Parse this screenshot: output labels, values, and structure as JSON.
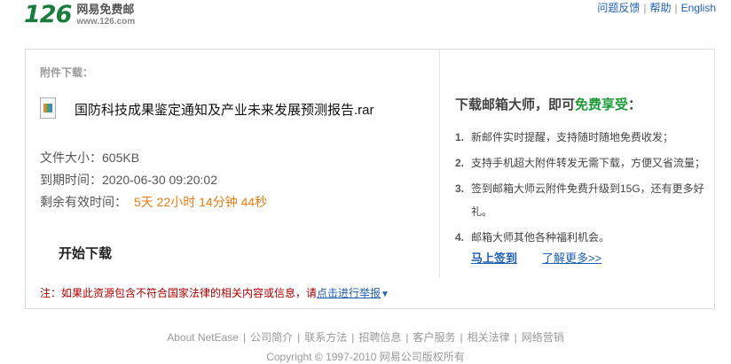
{
  "header": {
    "logo_number": "126",
    "logo_name": "网易免费邮",
    "logo_url": "www.126.com",
    "links": [
      "问题反馈",
      "帮助",
      "English"
    ]
  },
  "attachment": {
    "section_title": "附件下载：",
    "file_name": "国防科技成果鉴定通知及产业未来发展预测报告.rar",
    "size_label": "文件大小：",
    "size_value": "605KB",
    "expire_label": "到期时间：",
    "expire_value": "2020-06-30 09:20:02",
    "remaining_label": "剩余有效时间：",
    "remaining_value": "5天 22小时 14分钟 44秒",
    "download_button": "开始下载",
    "note_prefix": "注：如果此资源包含不符合国家法律的相关内容或信息，请",
    "note_link": "点击进行举报"
  },
  "promo": {
    "title_prefix": "下载邮箱大师，即可",
    "title_free": "免费享受",
    "title_suffix": "：",
    "items": [
      {
        "num": "1.",
        "text": "新邮件实时提醒，支持随时随地免费收发；"
      },
      {
        "num": "2.",
        "text": "支持手机超大附件转发无需下载，方便又省流量；"
      },
      {
        "num": "3.",
        "text": "签到邮箱大师云附件免费升级到15G，还有更多好礼。"
      },
      {
        "num": "4.",
        "text": "邮箱大师其他各种福利机会。"
      }
    ],
    "signin_link": "马上签到",
    "more_link": "了解更多>>"
  },
  "footer": {
    "links": [
      "About NetEase",
      "公司简介",
      "联系方法",
      "招聘信息",
      "客户服务",
      "相关法律",
      "网络营销"
    ],
    "copyright": "Copyright © 1997-2010 网易公司版权所有"
  }
}
